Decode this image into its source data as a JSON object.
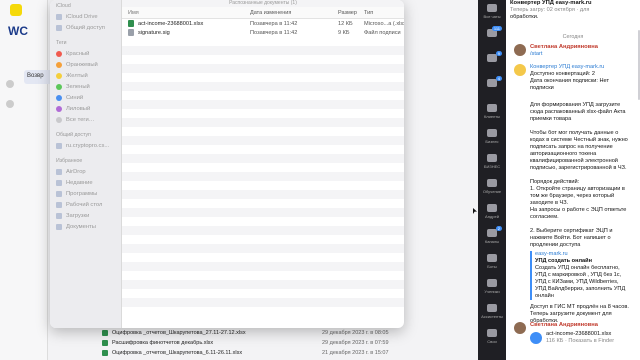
{
  "background": {
    "letters": "WC",
    "fragment": "Возвр",
    "behind_files": [
      {
        "name": "Оцифровка _отчетов_Шкарупетова_27.11-27.12.xlsx",
        "date": "29 декабря 2023 г. в 08:00"
      },
      {
        "name": "Оцифровка _отчетов_Шкарупетова_27.11-27.12.xlsx",
        "date": "29 декабря 2023 г. в 08:05"
      },
      {
        "name": "Расшифровка финотчетов декабрь.xlsx",
        "date": "29 декабря 2023 г. в 07:59"
      },
      {
        "name": "Оцифровка _отчетов_Шкарупетова_6.11-26.11.xlsx",
        "date": "21 декабря 2023 г. в 15:07"
      }
    ]
  },
  "finder": {
    "top_label": "Распознанные документы (1)",
    "sidebar": {
      "icloud_header": "iCloud",
      "icloud_items": [
        "iCloud Drive",
        "Общий доступ"
      ],
      "tags_header": "Теги",
      "tags": [
        {
          "label": "Красный",
          "color": "#f05a4f"
        },
        {
          "label": "Оранжевый",
          "color": "#f5a03a"
        },
        {
          "label": "Желтый",
          "color": "#f4cf3c"
        },
        {
          "label": "Зеленый",
          "color": "#5cc75a"
        },
        {
          "label": "Синий",
          "color": "#4a8ff0"
        },
        {
          "label": "Лиловый",
          "color": "#b06bd6"
        },
        {
          "label": "Все теги…",
          "color": "#c9c9cc"
        }
      ],
      "shared_header": "Общий доступ",
      "shared_items": [
        "ru.cryptopro.cs..."
      ],
      "favorites_header": "Избранное",
      "favorites": [
        "AirDrop",
        "Недавние",
        "Программы",
        "Рабочий стол",
        "Загрузки",
        "Документы"
      ]
    },
    "columns": {
      "name": "Имя",
      "date": "Дата изменения",
      "size": "Размер",
      "kind": "Тип"
    },
    "files": [
      {
        "name": "act-income-23688001.xlsx",
        "date": "Позавчера в 11:42",
        "size": "12 КБ",
        "kind": "Microso...а (.xlsx)",
        "icon_color": "#2f8f4e"
      },
      {
        "name": "signature.sig",
        "date": "Позавчера в 11:42",
        "size": "9 КБ",
        "kind": "Файл подписи",
        "icon_color": "#9aa0aa"
      }
    ]
  },
  "telegram": {
    "rail": [
      {
        "label": "Все чаты",
        "badge": ""
      },
      {
        "label": "",
        "badge": "111"
      },
      {
        "label": "",
        "badge": "9"
      },
      {
        "label": "",
        "badge": "4"
      },
      {
        "label": "Клиенты",
        "badge": ""
      },
      {
        "label": "Бизнес",
        "badge": ""
      },
      {
        "label": "БИЗНЕС",
        "badge": ""
      },
      {
        "label": "Обучение",
        "badge": ""
      },
      {
        "label": "Андрей",
        "badge": ""
      },
      {
        "label": "Каналы",
        "badge": "2"
      },
      {
        "label": "Боты",
        "badge": ""
      },
      {
        "label": "Ученики",
        "badge": ""
      },
      {
        "label": "Ассистенты",
        "badge": ""
      },
      {
        "label": "Свои",
        "badge": ""
      }
    ],
    "chat": {
      "header_title": "Конвертер УПД easy-mark.ru",
      "header_lines": [
        "обработки.",
        "Теперь загру: 02 октября · для",
        "обработки."
      ],
      "date_sep": "Сегодня",
      "author": "Светлана Андрияновна",
      "start_cmd": "/start",
      "bot_name": "Конвертер УПД easy-mark.ru",
      "bot_lines": [
        "Доступно конвертаций: 2",
        "Дата окончания подписки: Нет",
        "подписки"
      ],
      "body": [
        "Для формирования УПД загрузите",
        "сюда распакованный xlsx-файл Акта",
        "приемки товара",
        "",
        "Чтобы бот мог получать данные о",
        "кодах в системе Честный знак, нужно",
        "подписать запрос на получение",
        "авторизационного токена",
        "квалифицированной электронной",
        "подписью, зарегистрированной в ЧЗ.",
        "",
        "Порядок действий:",
        "1. Откройте страницу авторизации в",
        "том же браузере, через который",
        "заходите в ЧЗ.",
        "На запросы о работе с ЭЦП ответьте",
        "согласием.",
        "",
        "2. Выберите сертификат ЭЦП и",
        "нажмите Войти. Бот напишет о",
        "продлении доступа"
      ],
      "card_site": "easy-mark.ru",
      "card_title": "УПД создать онлайн",
      "card_lines": [
        "Создать УПД онлайн бесплатно,",
        "УПД с маркировкой , УПД без 1с,",
        "УПД с КИЗами, УПД Wildberries,",
        "УПД Вайлдберриз, заполнить УПД",
        "онлайн"
      ],
      "after_card": [
        "Доступ в ГИС МТ продлён на 8 часов.",
        "Теперь загрузите документ для",
        "обработки."
      ],
      "last_author": "Светлана Андрияновна",
      "file_name": "act-income-23688001.xlsx",
      "file_meta": "116 КБ · Показать в Finder"
    }
  }
}
